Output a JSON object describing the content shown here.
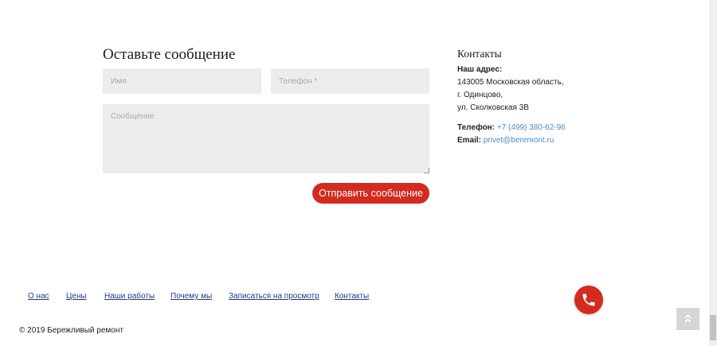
{
  "form": {
    "title": "Оставьте сообщение",
    "name_placeholder": "Имя",
    "phone_placeholder": "Телефон *",
    "message_placeholder": "Сообщение",
    "submit_label": "Отправить сообщение"
  },
  "contacts": {
    "title": "Контакты",
    "address_label": "Наш адрес:",
    "address_lines": [
      "143005 Московская область,",
      "г. Одинцово,",
      "ул. Сколковская 3В"
    ],
    "phone_label": "Телефон:",
    "phone_value": "+7 (499) 380-62-96",
    "email_label": "Email:",
    "email_value": "privet@beremont.ru"
  },
  "footer": {
    "nav": [
      "О нас",
      "Цены",
      "Наши работы",
      "Почему мы",
      "Записаться на просмотр",
      "Контакты"
    ],
    "copyright": "© 2019 Бережливый ремонт"
  },
  "icons": {
    "call": "phone-icon",
    "scroll_top": "double-chevron-up-icon"
  },
  "colors": {
    "accent": "#d42a1f",
    "link": "#4a8ccf",
    "nav_link": "#1e3a8a",
    "field_bg": "#ececec"
  }
}
